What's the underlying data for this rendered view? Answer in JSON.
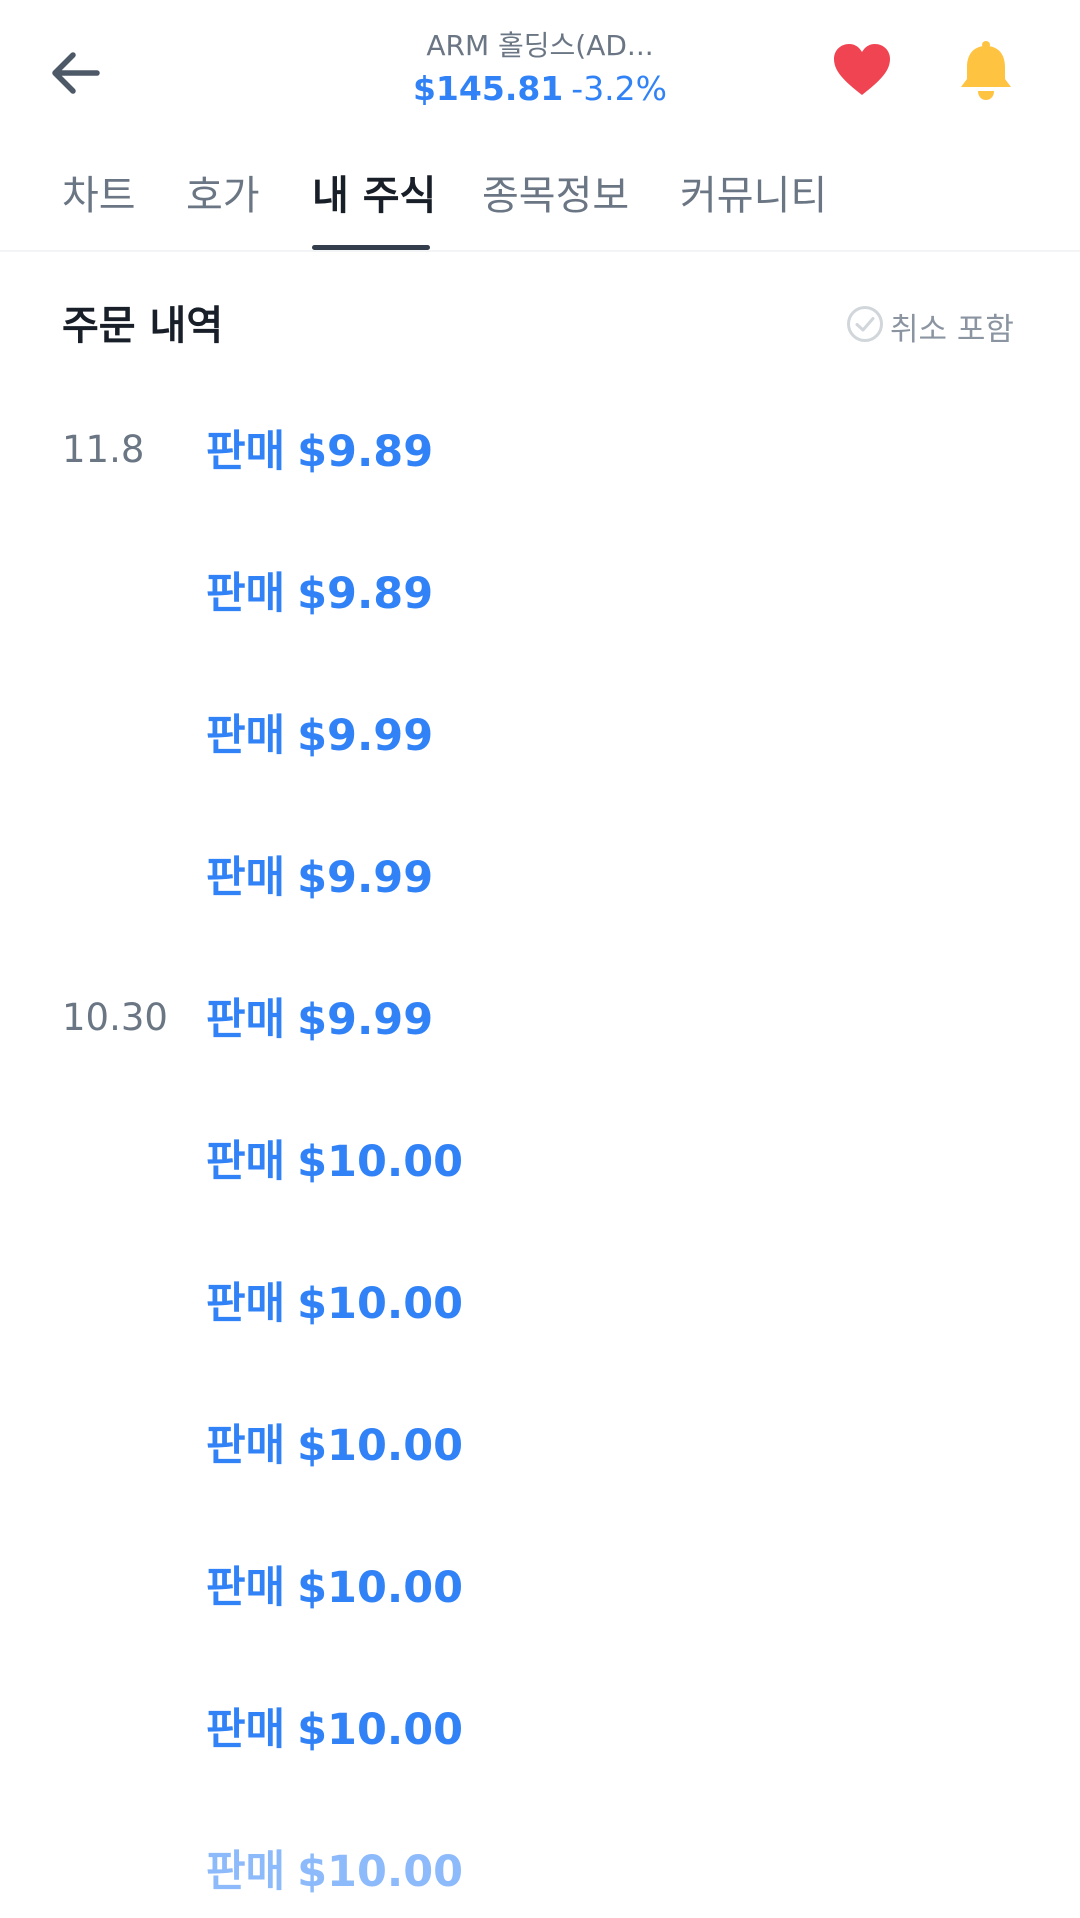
{
  "header": {
    "back_icon": "arrow-left-icon",
    "stock_name": "ARM 홀딩스(AD...",
    "price": "$145.81",
    "change": "-3.2%",
    "heart_icon": "heart-icon",
    "bell_icon": "bell-icon",
    "colors": {
      "price": "#3182f6",
      "heart": "#f04452",
      "bell": "#ffc342"
    }
  },
  "tabs": [
    {
      "label": "차트",
      "active": false
    },
    {
      "label": "호가",
      "active": false
    },
    {
      "label": "내 주식",
      "active": true
    },
    {
      "label": "종목정보",
      "active": false
    },
    {
      "label": "커뮤니티",
      "active": false
    }
  ],
  "orders_section": {
    "title": "주문 내역",
    "filter_icon": "check-circle-icon",
    "filter_label": "취소 포함",
    "filter_checked": false
  },
  "orders": [
    {
      "date": "11.8",
      "kind": "판매",
      "price": "$9.89"
    },
    {
      "date": "",
      "kind": "판매",
      "price": "$9.89"
    },
    {
      "date": "",
      "kind": "판매",
      "price": "$9.99"
    },
    {
      "date": "",
      "kind": "판매",
      "price": "$9.99"
    },
    {
      "date": "10.30",
      "kind": "판매",
      "price": "$9.99"
    },
    {
      "date": "",
      "kind": "판매",
      "price": "$10.00"
    },
    {
      "date": "",
      "kind": "판매",
      "price": "$10.00"
    },
    {
      "date": "",
      "kind": "판매",
      "price": "$10.00"
    },
    {
      "date": "",
      "kind": "판매",
      "price": "$10.00"
    },
    {
      "date": "",
      "kind": "판매",
      "price": "$10.00"
    },
    {
      "date": "",
      "kind": "판매",
      "price": "$10.00"
    }
  ]
}
